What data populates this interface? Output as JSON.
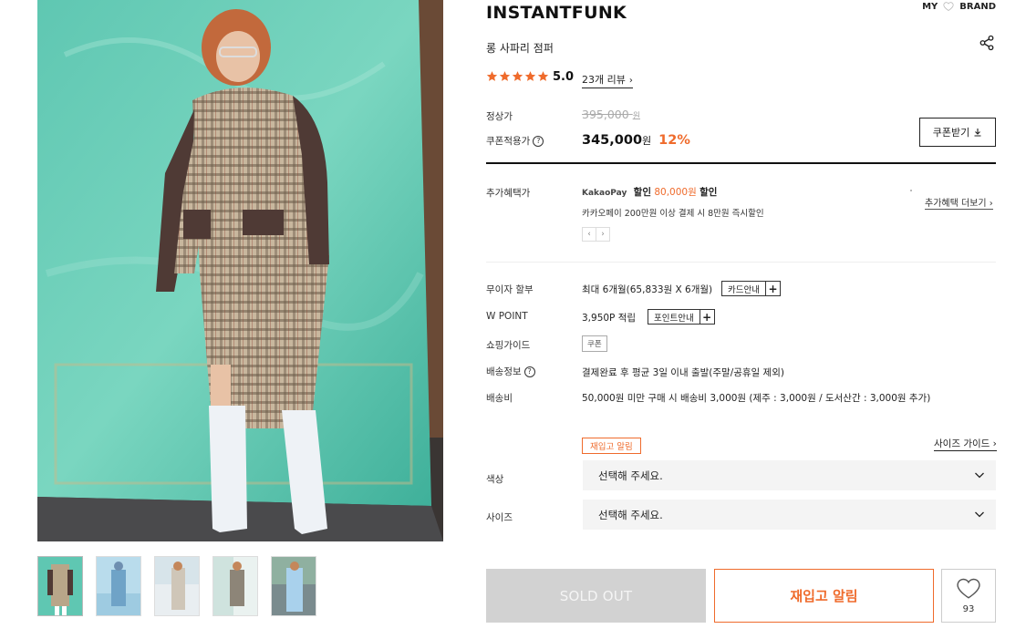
{
  "top_nav": {
    "my": "MY",
    "brand": "BRAND"
  },
  "product": {
    "brand": "INSTANTFUNK",
    "name": "롱 사파리 점퍼",
    "rating_stars": 5,
    "rating": "5.0",
    "review_link": "23개 리뷰"
  },
  "price": {
    "regular_label": "정상가",
    "regular_value": "395,000",
    "regular_unit": "원",
    "coupon_label": "쿠폰적용가",
    "coupon_value": "345,000",
    "coupon_unit": "원",
    "discount": "12%",
    "coupon_button": "쿠폰받기"
  },
  "benefits": {
    "label": "추가혜택가",
    "kakaopay": "KakaoPay",
    "discount_word": "할인",
    "amount": "80,000원",
    "discount_suffix": "할인",
    "sub": "카카오페이 200만원 이상 결제 시 8만원 즉시할인",
    "more_link": "추가혜택 더보기"
  },
  "info": {
    "installment_label": "무이자 할부",
    "installment_value": "최대 6개월(65,833원 X 6개월)",
    "card_button": "카드안내",
    "wpoint_label": "W POINT",
    "wpoint_value": "3,950P 적립",
    "point_button": "포인트안내",
    "guide_label": "쇼핑가이드",
    "guide_button": "쿠폰",
    "shipping_label": "배송정보",
    "shipping_value": "결제완료 후 평균 3일 이내 출발(주말/공휴일 제외)",
    "fee_label": "배송비",
    "fee_value": "50,000원 미만 구매 시 배송비 3,000원 (제주 : 3,000원 / 도서산간 : 3,000원 추가)"
  },
  "options": {
    "restock_tag": "재입고 알림",
    "size_guide": "사이즈 가이드",
    "color_label": "색상",
    "color_value": "선택해 주세요.",
    "size_label": "사이즈",
    "size_value": "선택해 주세요."
  },
  "actions": {
    "soldout": "SOLD OUT",
    "restock": "재입고 알림",
    "wish_count": "93"
  },
  "colors": {
    "accent": "#ef6b2c",
    "soldout_bg": "#d2d2d2"
  }
}
